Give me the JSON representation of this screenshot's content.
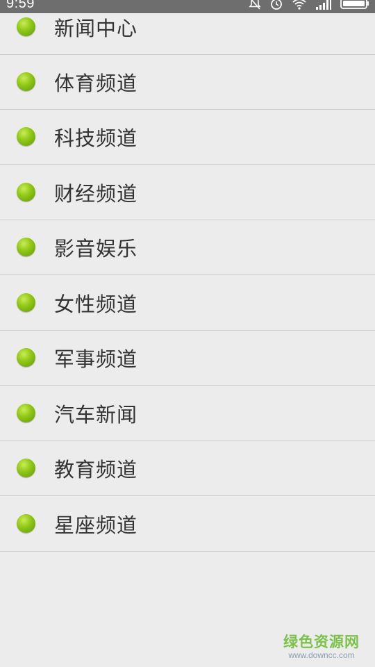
{
  "status_bar": {
    "time": "9:59",
    "icons": [
      "bell-off-icon",
      "alarm-icon",
      "wifi-icon",
      "signal-icon",
      "battery-icon"
    ]
  },
  "channels": [
    {
      "label": "新闻中心"
    },
    {
      "label": "体育频道"
    },
    {
      "label": "科技频道"
    },
    {
      "label": "财经频道"
    },
    {
      "label": "影音娱乐"
    },
    {
      "label": "女性频道"
    },
    {
      "label": "军事频道"
    },
    {
      "label": "汽车新闻"
    },
    {
      "label": "教育频道"
    },
    {
      "label": "星座频道"
    }
  ],
  "watermark": {
    "title": "绿色资源网",
    "url": "www.downcc.com"
  },
  "colors": {
    "background": "#ececec",
    "status_bar": "#6e6e6e",
    "dot": "#8bc21a",
    "text": "#333333",
    "divider": "#cfcfcf",
    "watermark": "#7cc24a"
  }
}
